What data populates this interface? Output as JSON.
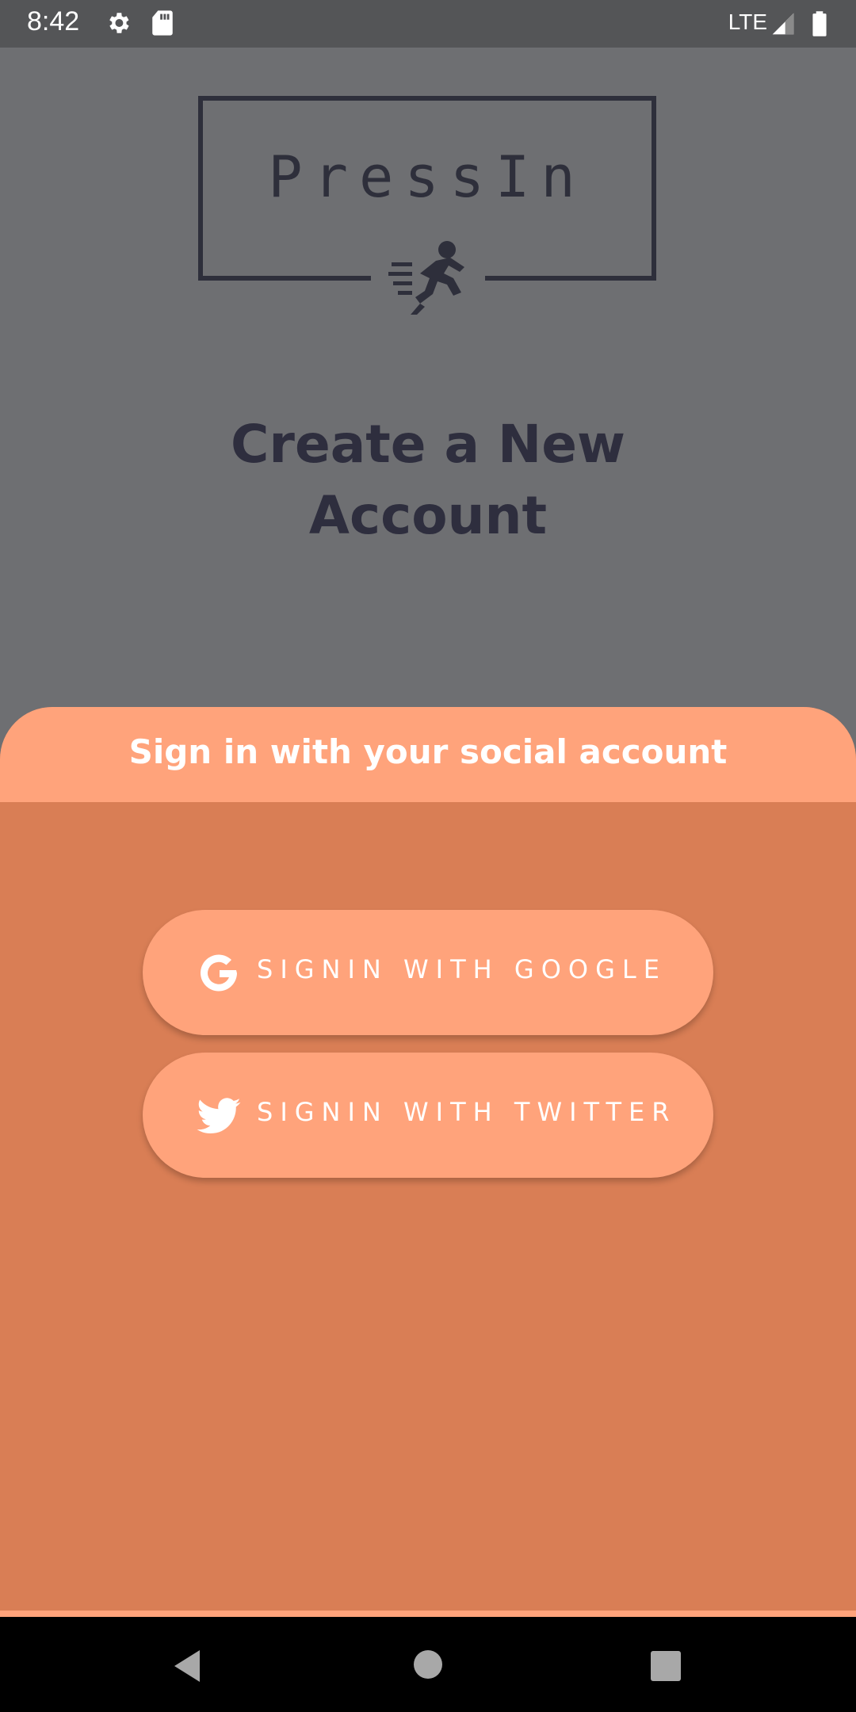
{
  "status_bar": {
    "time": "8:42",
    "network": "LTE",
    "icons": [
      "gear-icon",
      "sd-card-icon",
      "signal-icon",
      "battery-icon"
    ]
  },
  "logo": {
    "text": "PressIn",
    "icon": "running-person-icon"
  },
  "page": {
    "title_line1": "Create a New",
    "title_line2": "Account"
  },
  "sheet": {
    "title": "Sign in with your social account",
    "buttons": [
      {
        "label": "SIGNIN WITH GOOGLE",
        "icon": "google-icon"
      },
      {
        "label": "SIGNIN WITH TWITTER",
        "icon": "twitter-icon"
      }
    ]
  },
  "nav_bar": {
    "icons": [
      "back-icon",
      "home-icon",
      "recents-icon"
    ]
  },
  "colors": {
    "overlay": "#6e6f72",
    "sheet_body": "#d97e55",
    "accent": "#ffa37b",
    "title_text": "#2e2e3e"
  }
}
